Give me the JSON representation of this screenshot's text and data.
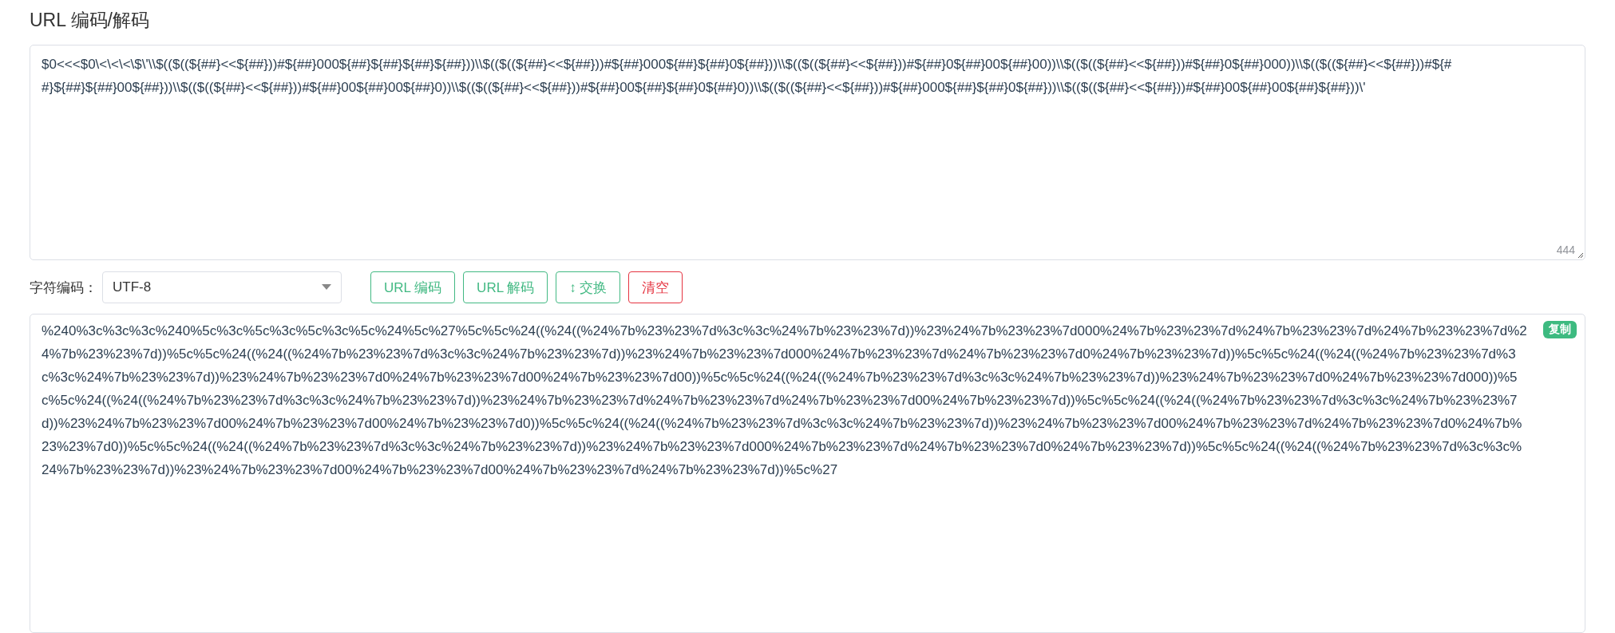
{
  "title": "URL 编码/解码",
  "input": {
    "value": "$0<<<$0\\<\\<\\<\\$\\'\\\\$(($((${##}<<${##}))#${##}000${##}${##}${##}${##}))\\\\$(($((${##}<<${##}))#${##}000${##}${##}0${##}))\\\\$(($((${##}<<${##}))#${##}0${##}00${##}00))\\\\$(($((${##}<<${##}))#${##}0${##}000))\\\\$(($((${##}<<${##}))#${##}${##}${##}00${##}))\\\\$(($((${##}<<${##}))#${##}00${##}00${##}0))\\\\$(($((${##}<<${##}))#${##}00${##}${##}0${##}0))\\\\$(($((${##}<<${##}))#${##}000${##}${##}0${##}))\\\\$(($((${##}<<${##}))#${##}00${##}00${##}${##}))\\'",
    "char_count": "444"
  },
  "charset": {
    "label": "字符编码：",
    "value": "UTF-8"
  },
  "buttons": [
    {
      "label": "URL 编码",
      "kind": "primary"
    },
    {
      "label": "URL 解码",
      "kind": "primary"
    },
    {
      "label": "↕ 交换",
      "kind": "primary"
    },
    {
      "label": "清空",
      "kind": "danger"
    }
  ],
  "output": {
    "value": "%240%3c%3c%3c%240%5c%3c%5c%3c%5c%3c%5c%24%5c%27%5c%5c%24((%24((%24%7b%23%23%7d%3c%3c%24%7b%23%23%7d))%23%24%7b%23%23%7d000%24%7b%23%23%7d%24%7b%23%23%7d%24%7b%23%23%7d%24%7b%23%23%7d))%5c%5c%24((%24((%24%7b%23%23%7d%3c%3c%24%7b%23%23%7d))%23%24%7b%23%23%7d000%24%7b%23%23%7d%24%7b%23%23%7d0%24%7b%23%23%7d))%5c%5c%24((%24((%24%7b%23%23%7d%3c%3c%24%7b%23%23%7d))%23%24%7b%23%23%7d0%24%7b%23%23%7d00%24%7b%23%23%7d00))%5c%5c%24((%24((%24%7b%23%23%7d%3c%3c%24%7b%23%23%7d))%23%24%7b%23%23%7d0%24%7b%23%23%7d000))%5c%5c%24((%24((%24%7b%23%23%7d%3c%3c%24%7b%23%23%7d))%23%24%7b%23%23%7d%24%7b%23%23%7d%24%7b%23%23%7d00%24%7b%23%23%7d))%5c%5c%24((%24((%24%7b%23%23%7d%3c%3c%24%7b%23%23%7d))%23%24%7b%23%23%7d00%24%7b%23%23%7d00%24%7b%23%23%7d0))%5c%5c%24((%24((%24%7b%23%23%7d%3c%3c%24%7b%23%23%7d))%23%24%7b%23%23%7d00%24%7b%23%23%7d%24%7b%23%23%7d0%24%7b%23%23%7d0))%5c%5c%24((%24((%24%7b%23%23%7d%3c%3c%24%7b%23%23%7d))%23%24%7b%23%23%7d000%24%7b%23%23%7d%24%7b%23%23%7d0%24%7b%23%23%7d))%5c%5c%24((%24((%24%7b%23%23%7d%3c%3c%24%7b%23%23%7d))%23%24%7b%23%23%7d00%24%7b%23%23%7d00%24%7b%23%23%7d%24%7b%23%23%7d))%5c%27",
    "copy_label": "复制"
  }
}
